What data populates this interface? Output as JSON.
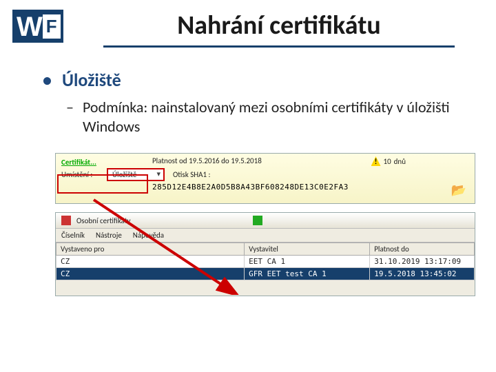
{
  "title": "Nahrání certifikátu",
  "bullets": {
    "b1": "Úložiště",
    "b2": "Podmínka: nainstalovaný mezi osobními certifikáty v úložišti Windows"
  },
  "panel1": {
    "cert_label": "Certifikát...",
    "validity": "Platnost od 19.5.2016 do 19.5.2018",
    "days": "10",
    "days_unit": "dnů",
    "loc_label": "Umístění :",
    "loc_value": "Úložiště",
    "sha_label": "Otisk SHA1 :",
    "sha_value": "285D12E4B8E2A0D5B8A43BF608248DE13C0E2FA3"
  },
  "panel2": {
    "window_title": "Osobní certifikáty",
    "menu": [
      "Číselník",
      "Nástroje",
      "Nápověda"
    ],
    "columns": [
      "Vystaveno pro",
      "Vystavitel",
      "Platnost do"
    ],
    "rows": [
      {
        "issued_to": "CZ",
        "issuer": "EET CA 1",
        "expires": "31.10.2019 13:17:09",
        "selected": false
      },
      {
        "issued_to": "CZ",
        "issuer": "GFR EET test CA 1",
        "expires": "19.5.2018 13:45:02",
        "selected": true
      }
    ]
  }
}
